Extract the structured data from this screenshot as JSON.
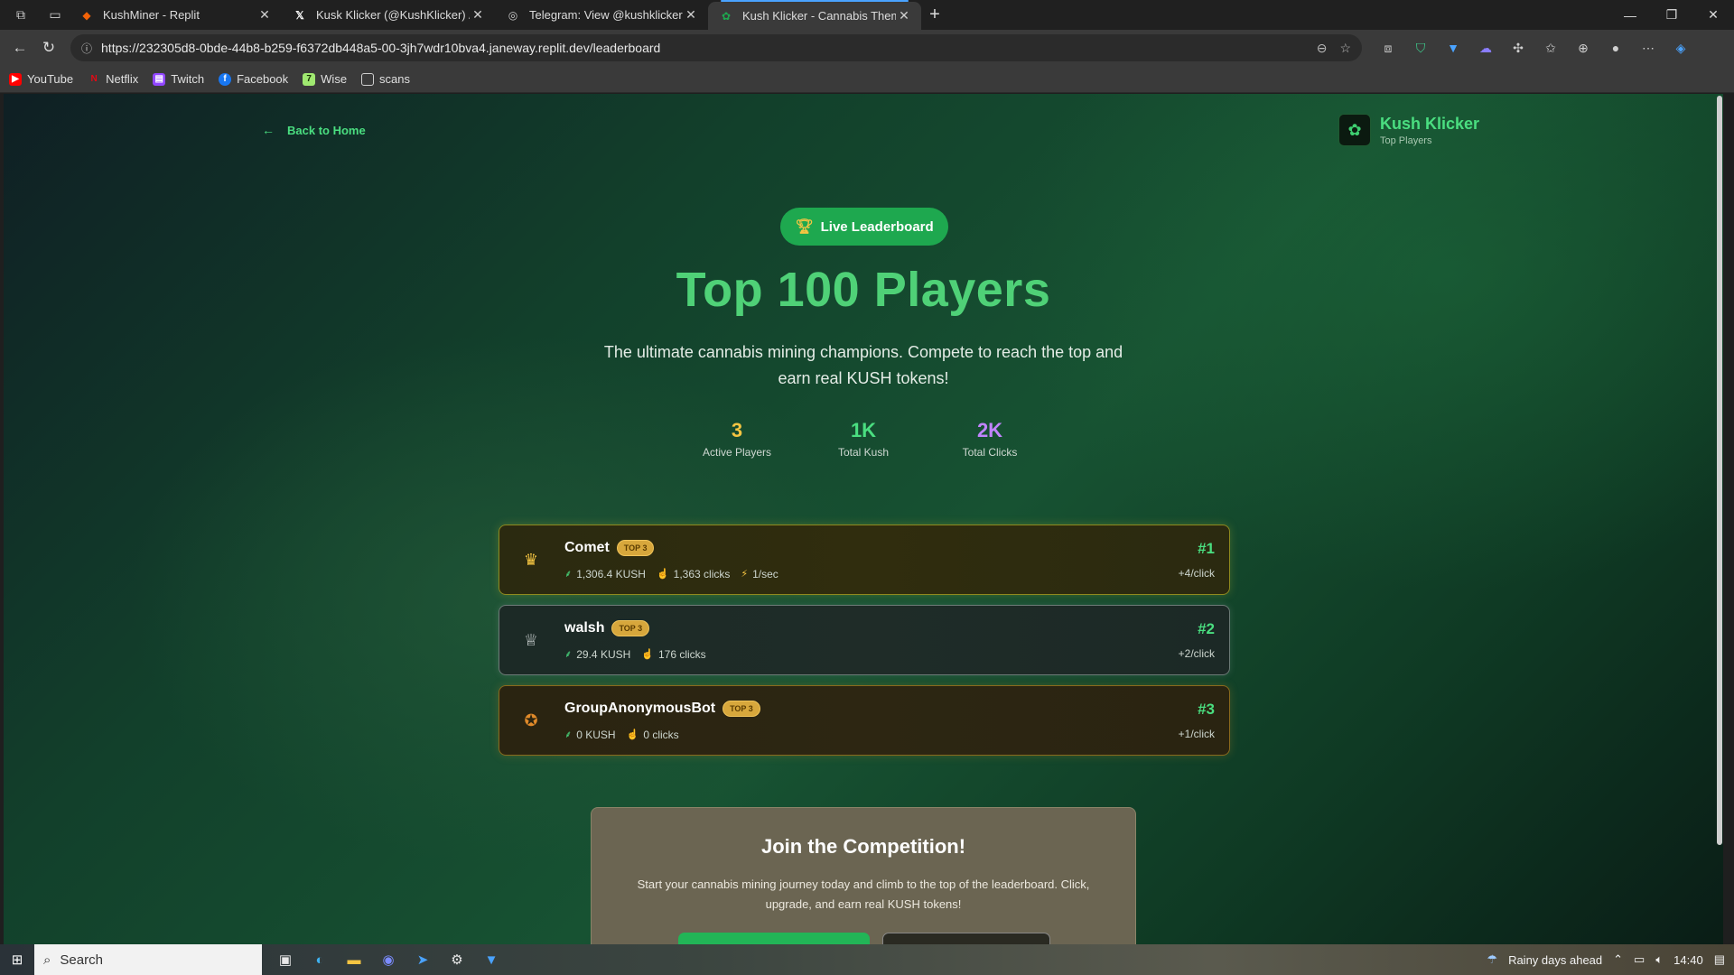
{
  "browser": {
    "tabs": [
      {
        "title": "KushMiner - Replit",
        "icon": "replit-icon",
        "color": "#f26207"
      },
      {
        "title": "Kusk Klicker (@KushKlicker) / X",
        "icon": "x-icon",
        "color": "#000000"
      },
      {
        "title": "Telegram: View @kushklicker",
        "icon": "globe-icon",
        "color": "#cfcfcf"
      },
      {
        "title": "Kush Klicker - Cannabis Themed C",
        "icon": "cannabis-icon",
        "color": "#1ea84f"
      }
    ],
    "url": "https://232305d8-0bde-44b8-b259-f6372db448a5-00-3jh7wdr10bva4.janeway.replit.dev/leaderboard",
    "bookmarks": [
      {
        "label": "YouTube",
        "icon": "youtube-icon",
        "color": "#ff0000"
      },
      {
        "label": "Netflix",
        "icon": "netflix-icon",
        "color": "#e50914"
      },
      {
        "label": "Twitch",
        "icon": "twitch-icon",
        "color": "#9146ff"
      },
      {
        "label": "Facebook",
        "icon": "facebook-icon",
        "color": "#1877f2"
      },
      {
        "label": "Wise",
        "icon": "wise-icon",
        "color": "#9fe870"
      },
      {
        "label": "scans",
        "icon": "folder-icon",
        "color": "#cfcfcf"
      }
    ]
  },
  "page": {
    "back_label": "Back to Home",
    "brand": {
      "name": "Kush Klicker",
      "subtitle": "Top Players"
    },
    "pill_label": "Live Leaderboard",
    "title": "Top 100 Players",
    "subtitle": "The ultimate cannabis mining champions. Compete to reach the top and earn real KUSH tokens!",
    "stats": [
      {
        "value": "3",
        "label": "Active Players",
        "color": "#f5c542"
      },
      {
        "value": "1K",
        "label": "Total Kush",
        "color": "#4ade80"
      },
      {
        "value": "2K",
        "label": "Total Clicks",
        "color": "#c084fc"
      }
    ],
    "players": [
      {
        "name": "Comet",
        "badge": "TOP 3",
        "kush": "1,306.4 KUSH",
        "clicks": "1,363 clicks",
        "rate": "1/sec",
        "rank": "#1",
        "per_click": "+4/click",
        "icon": "crown-icon",
        "tier": "gold"
      },
      {
        "name": "walsh",
        "badge": "TOP 3",
        "kush": "29.4 KUSH",
        "clicks": "176 clicks",
        "rate": "",
        "rank": "#2",
        "per_click": "+2/click",
        "icon": "trophy-icon",
        "tier": "silver"
      },
      {
        "name": "GroupAnonymousBot",
        "badge": "TOP 3",
        "kush": "0 KUSH",
        "clicks": "0 clicks",
        "rate": "",
        "rank": "#3",
        "per_click": "+1/click",
        "icon": "medal-icon",
        "tier": "bronze"
      }
    ],
    "join": {
      "title": "Join the Competition!",
      "description": "Start your cannabis mining journey today and climb to the top of the leaderboard. Click, upgrade, and earn real KUSH tokens!"
    }
  },
  "taskbar": {
    "search_label": "Search",
    "weather": "Rainy days ahead",
    "time": "14:40"
  },
  "colors": {
    "accent": "#4ade80",
    "pill": "#1ea84f",
    "badge": "#d7a73c"
  }
}
